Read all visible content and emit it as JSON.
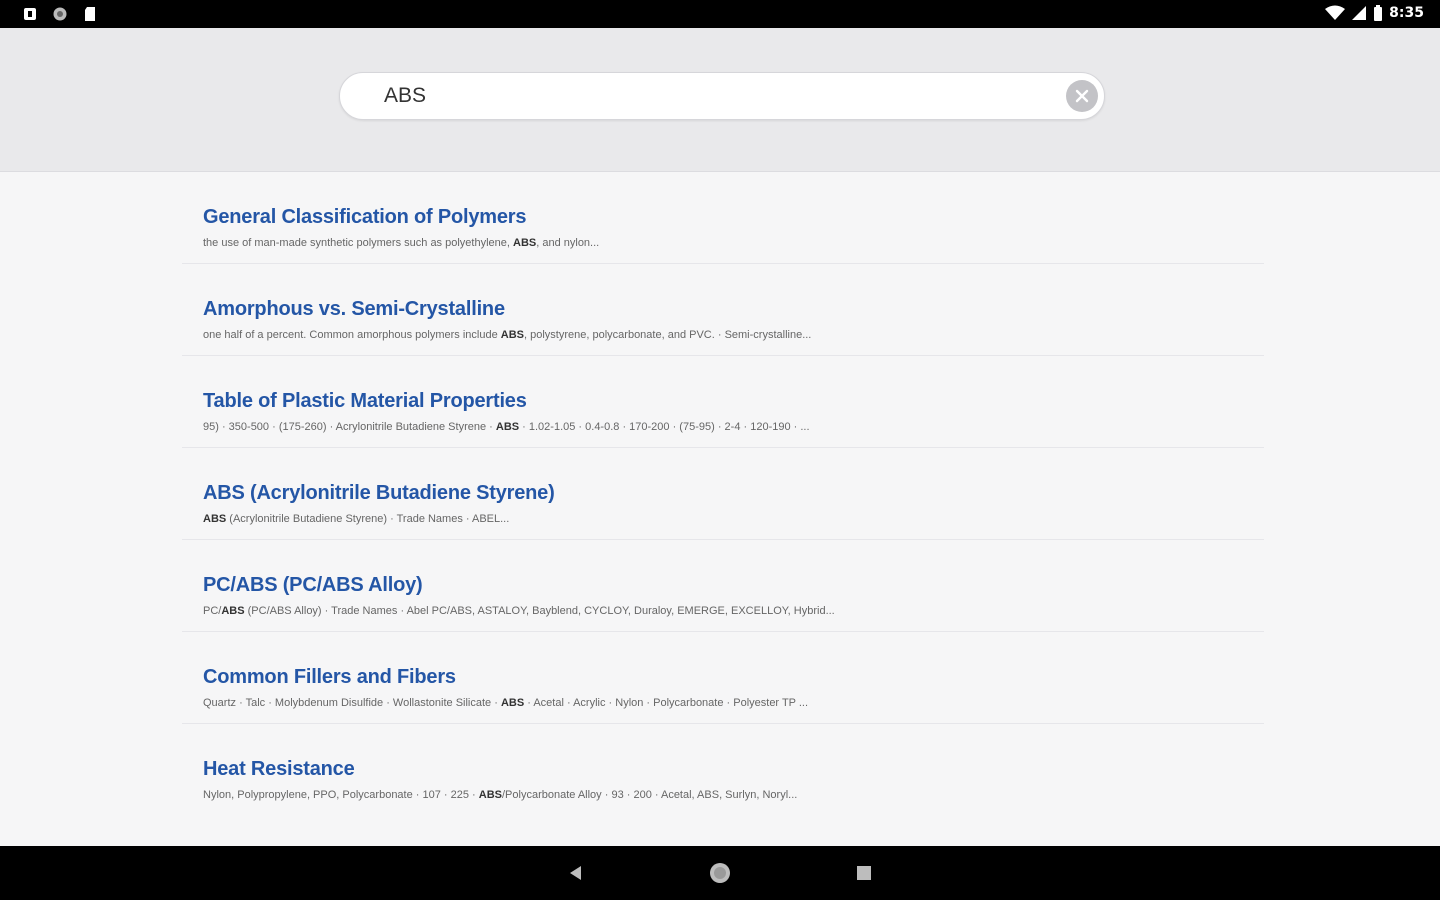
{
  "status_bar": {
    "time": "8:35",
    "left_icons": [
      "notification-icon",
      "circle-icon",
      "sd-card-icon"
    ],
    "right_icons": [
      "wifi-icon",
      "signal-icon",
      "battery-icon"
    ]
  },
  "search": {
    "value": "ABS",
    "clear_icon": "close-icon"
  },
  "results": [
    {
      "title": "General Classification of Polymers",
      "snippet_before": "the use of man-made synthetic polymers such as polyethylene, ",
      "snippet_match": "ABS",
      "snippet_after": ", and nylon..."
    },
    {
      "title": "Amorphous vs. Semi-Crystalline",
      "snippet_before": "one half of a percent. Common amorphous polymers include ",
      "snippet_match": "ABS",
      "snippet_after": ", polystyrene, polycarbonate, and PVC. · Semi-crystalline..."
    },
    {
      "title": "Table of Plastic Material Properties",
      "snippet_before": "95) · 350-500 · (175-260) · Acrylonitrile Butadiene Styrene · ",
      "snippet_match": "ABS",
      "snippet_after": " · 1.02-1.05 · 0.4-0.8 · 170-200 · (75-95) · 2-4 · 120-190 · ..."
    },
    {
      "title": "ABS (Acrylonitrile Butadiene Styrene)",
      "snippet_before": "",
      "snippet_match": "ABS",
      "snippet_after": " (Acrylonitrile Butadiene Styrene) · Trade Names · ABEL..."
    },
    {
      "title": "PC/ABS (PC/ABS Alloy)",
      "snippet_before": "PC/",
      "snippet_match": "ABS",
      "snippet_after": " (PC/ABS Alloy) · Trade Names · Abel PC/ABS, ASTALOY, Bayblend, CYCLOY, Duraloy, EMERGE, EXCELLOY, Hybrid..."
    },
    {
      "title": "Common Fillers and Fibers",
      "snippet_before": "Quartz · Talc · Molybdenum Disulfide · Wollastonite Silicate · ",
      "snippet_match": "ABS",
      "snippet_after": " · Acetal · Acrylic · Nylon · Polycarbonate · Polyester TP ..."
    },
    {
      "title": "Heat Resistance",
      "snippet_before": "Nylon, Polypropylene, PPO, Polycarbonate · 107 · 225 · ",
      "snippet_match": "ABS",
      "snippet_after": "/Polycarbonate Alloy · 93 · 200 · Acetal, ABS, Surlyn, Noryl..."
    }
  ],
  "nav_bar": {
    "icons": [
      "back-icon",
      "home-icon",
      "recents-icon"
    ]
  },
  "colors": {
    "title_link": "#2456a6",
    "header_bg": "#e9e9eb",
    "page_bg": "#f6f6f7"
  }
}
